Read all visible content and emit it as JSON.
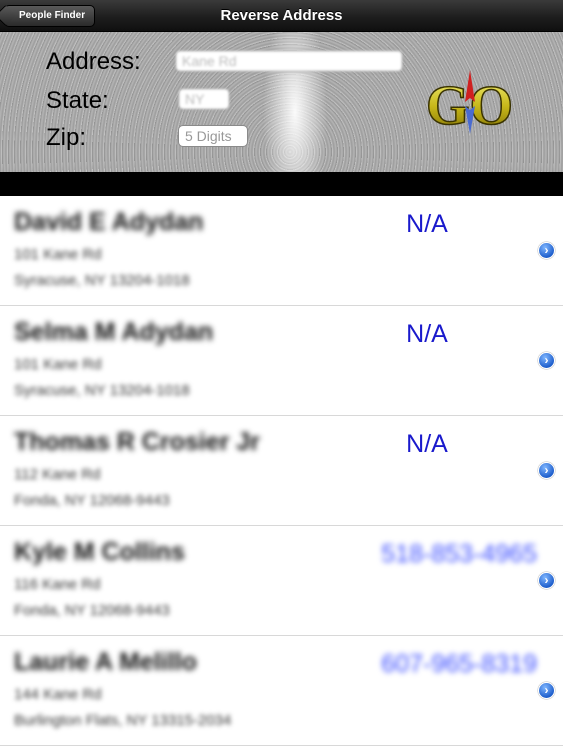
{
  "navbar": {
    "back_label": "People Finder",
    "title": "Reverse Address"
  },
  "form": {
    "address_label": "Address:",
    "address_value": "Kane Rd",
    "state_label": "State:",
    "state_value": "NY",
    "zip_label": "Zip:",
    "zip_placeholder": "5 Digits"
  },
  "logo": {
    "text": "GO",
    "icon": "compass-go-logo"
  },
  "results": [
    {
      "name": "David E Adydan",
      "street": "101 Kane Rd",
      "city": "Syracuse, NY 13204-1018",
      "phone": "N/A"
    },
    {
      "name": "Selma M Adydan",
      "street": "101 Kane Rd",
      "city": "Syracuse, NY 13204-1018",
      "phone": "N/A"
    },
    {
      "name": "Thomas R Crosier Jr",
      "street": "112 Kane Rd",
      "city": "Fonda, NY 12068-9443",
      "phone": "N/A"
    },
    {
      "name": "Kyle M Collins",
      "street": "116 Kane Rd",
      "city": "Fonda, NY 12068-9443",
      "phone": "518-853-4965"
    },
    {
      "name": "Laurie A Melillo",
      "street": "144 Kane Rd",
      "city": "Burlington Flats, NY 13315-2034",
      "phone": "607-965-8319"
    }
  ],
  "colors": {
    "phone_na": "#1a1acc",
    "phone": "#3a4cff",
    "disclosure": "#1f5fcc"
  }
}
